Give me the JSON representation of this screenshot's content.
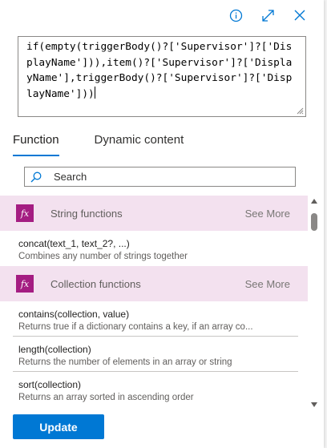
{
  "header": {
    "info_icon": "info-icon",
    "expand_icon": "expand-icon",
    "close_icon": "close-icon",
    "accent": "#0078d4"
  },
  "editor": {
    "expression": "if(empty(triggerBody()?['Supervisor']?['DisplayName'])),item()?['Supervisor']?['DisplayName'],triggerBody()?['Supervisor']?['DisplayName']))"
  },
  "tabs": [
    {
      "label": "Function",
      "active": true
    },
    {
      "label": "Dynamic content",
      "active": false
    }
  ],
  "search": {
    "placeholder": "Search",
    "icon": "search-icon"
  },
  "categories": [
    {
      "label": "String functions",
      "see_more": "See More",
      "icon": "fx-icon"
    },
    {
      "label": "Collection functions",
      "see_more": "See More",
      "icon": "fx-icon"
    }
  ],
  "functions": [
    {
      "signature": "concat(text_1, text_2?, ...)",
      "description": "Combines any number of strings together"
    },
    {
      "signature": "contains(collection, value)",
      "description": "Returns true if a dictionary contains a key, if an array co..."
    },
    {
      "signature": "length(collection)",
      "description": "Returns the number of elements in an array or string"
    },
    {
      "signature": "sort(collection)",
      "description": "Returns an array sorted in ascending order"
    }
  ],
  "footer": {
    "update_label": "Update"
  },
  "colors": {
    "category_bg": "#f3e1ef",
    "fx_bg": "#a41d82",
    "primary": "#0078d4"
  }
}
